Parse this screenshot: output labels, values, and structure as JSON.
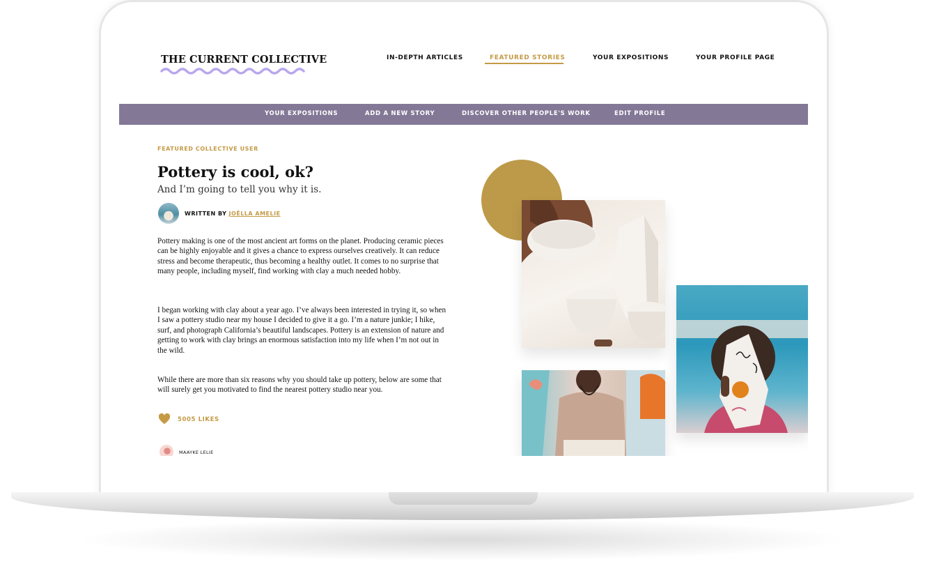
{
  "brand": {
    "title": "THE CURRENT COLLECTIVE",
    "wave_color": "#b9a8ec"
  },
  "top_nav": {
    "items": [
      {
        "label": "IN-DEPTH ARTICLES",
        "active": false
      },
      {
        "label": "FEATURED STORIES",
        "active": true
      },
      {
        "label": "YOUR EXPOSITIONS",
        "active": false
      },
      {
        "label": "YOUR PROFILE PAGE",
        "active": false
      }
    ]
  },
  "sub_nav": {
    "items": [
      {
        "label": "YOUR EXPOSITIONS"
      },
      {
        "label": "ADD A NEW STORY"
      },
      {
        "label": "DISCOVER OTHER PEOPLE'S WORK"
      },
      {
        "label": "EDIT PROFILE"
      }
    ]
  },
  "article": {
    "eyebrow": "FEATURED COLLECTIVE USER",
    "title": "Pottery is cool, ok?",
    "subtitle": "And I’m going to tell you why it is.",
    "written_by_label": "WRITTEN BY",
    "author_name": "JOËLLA AMELIE",
    "paragraphs": [
      "Pottery making is one of the most ancient art forms on the planet.  Producing ceramic pieces can be highly enjoyable and it gives a chance to express ourselves creatively. It can reduce stress and become therapeutic, thus becoming a healthy outlet.  It comes to no surprise that many people, including myself, find working with clay a much needed hobby.",
      "I began working with clay about a year ago. I’ve always been interested in trying it, so when I saw a pottery studio near my house I decided to give it a go. I’m a nature junkie; I hike, surf, and photograph California’s beautiful landscapes. Pottery is an extension of nature and getting to work with clay brings an enormous satisfaction into my life when I’m not out in the wild.",
      "While there are more than six reasons why you should take up pottery, below are some that will surely get you motivated to find the nearest pottery studio near you."
    ],
    "likes": "5005 LIKES",
    "comment_user": "MAAYKE LELIE"
  },
  "colors": {
    "accent_gold": "#c49a45",
    "subnav_purple": "#837896",
    "circle_gold": "#bd9a4a"
  },
  "icons": {
    "likes": "heart-icon"
  }
}
